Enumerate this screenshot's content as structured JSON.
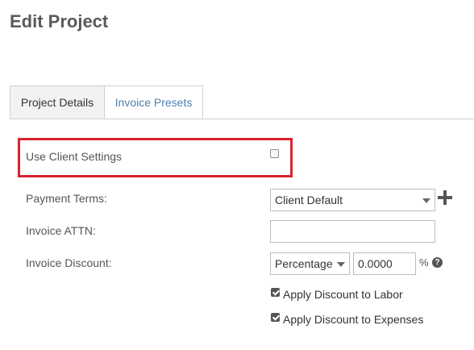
{
  "page": {
    "title": "Edit Project"
  },
  "tabs": [
    {
      "label": "Project Details",
      "active": false
    },
    {
      "label": "Invoice Presets",
      "active": true
    }
  ],
  "form": {
    "use_client_settings": {
      "label": "Use Client Settings",
      "checked": false
    },
    "payment_terms": {
      "label": "Payment Terms:",
      "value": "Client Default"
    },
    "invoice_attn": {
      "label": "Invoice ATTN:",
      "value": ""
    },
    "invoice_discount": {
      "label": "Invoice Discount:",
      "type_value": "Percentage",
      "amount": "0.0000",
      "unit": "%"
    },
    "apply_discount_labor": {
      "label": "Apply Discount to Labor",
      "checked": true
    },
    "apply_discount_expenses": {
      "label": "Apply Discount to Expenses",
      "checked": true
    }
  },
  "icons": {
    "add": "plus-icon",
    "help": "question-circle-icon",
    "dropdown": "caret-down-icon"
  },
  "colors": {
    "highlight": "#d9232f",
    "active_tab_text": "#4c7fb0"
  }
}
